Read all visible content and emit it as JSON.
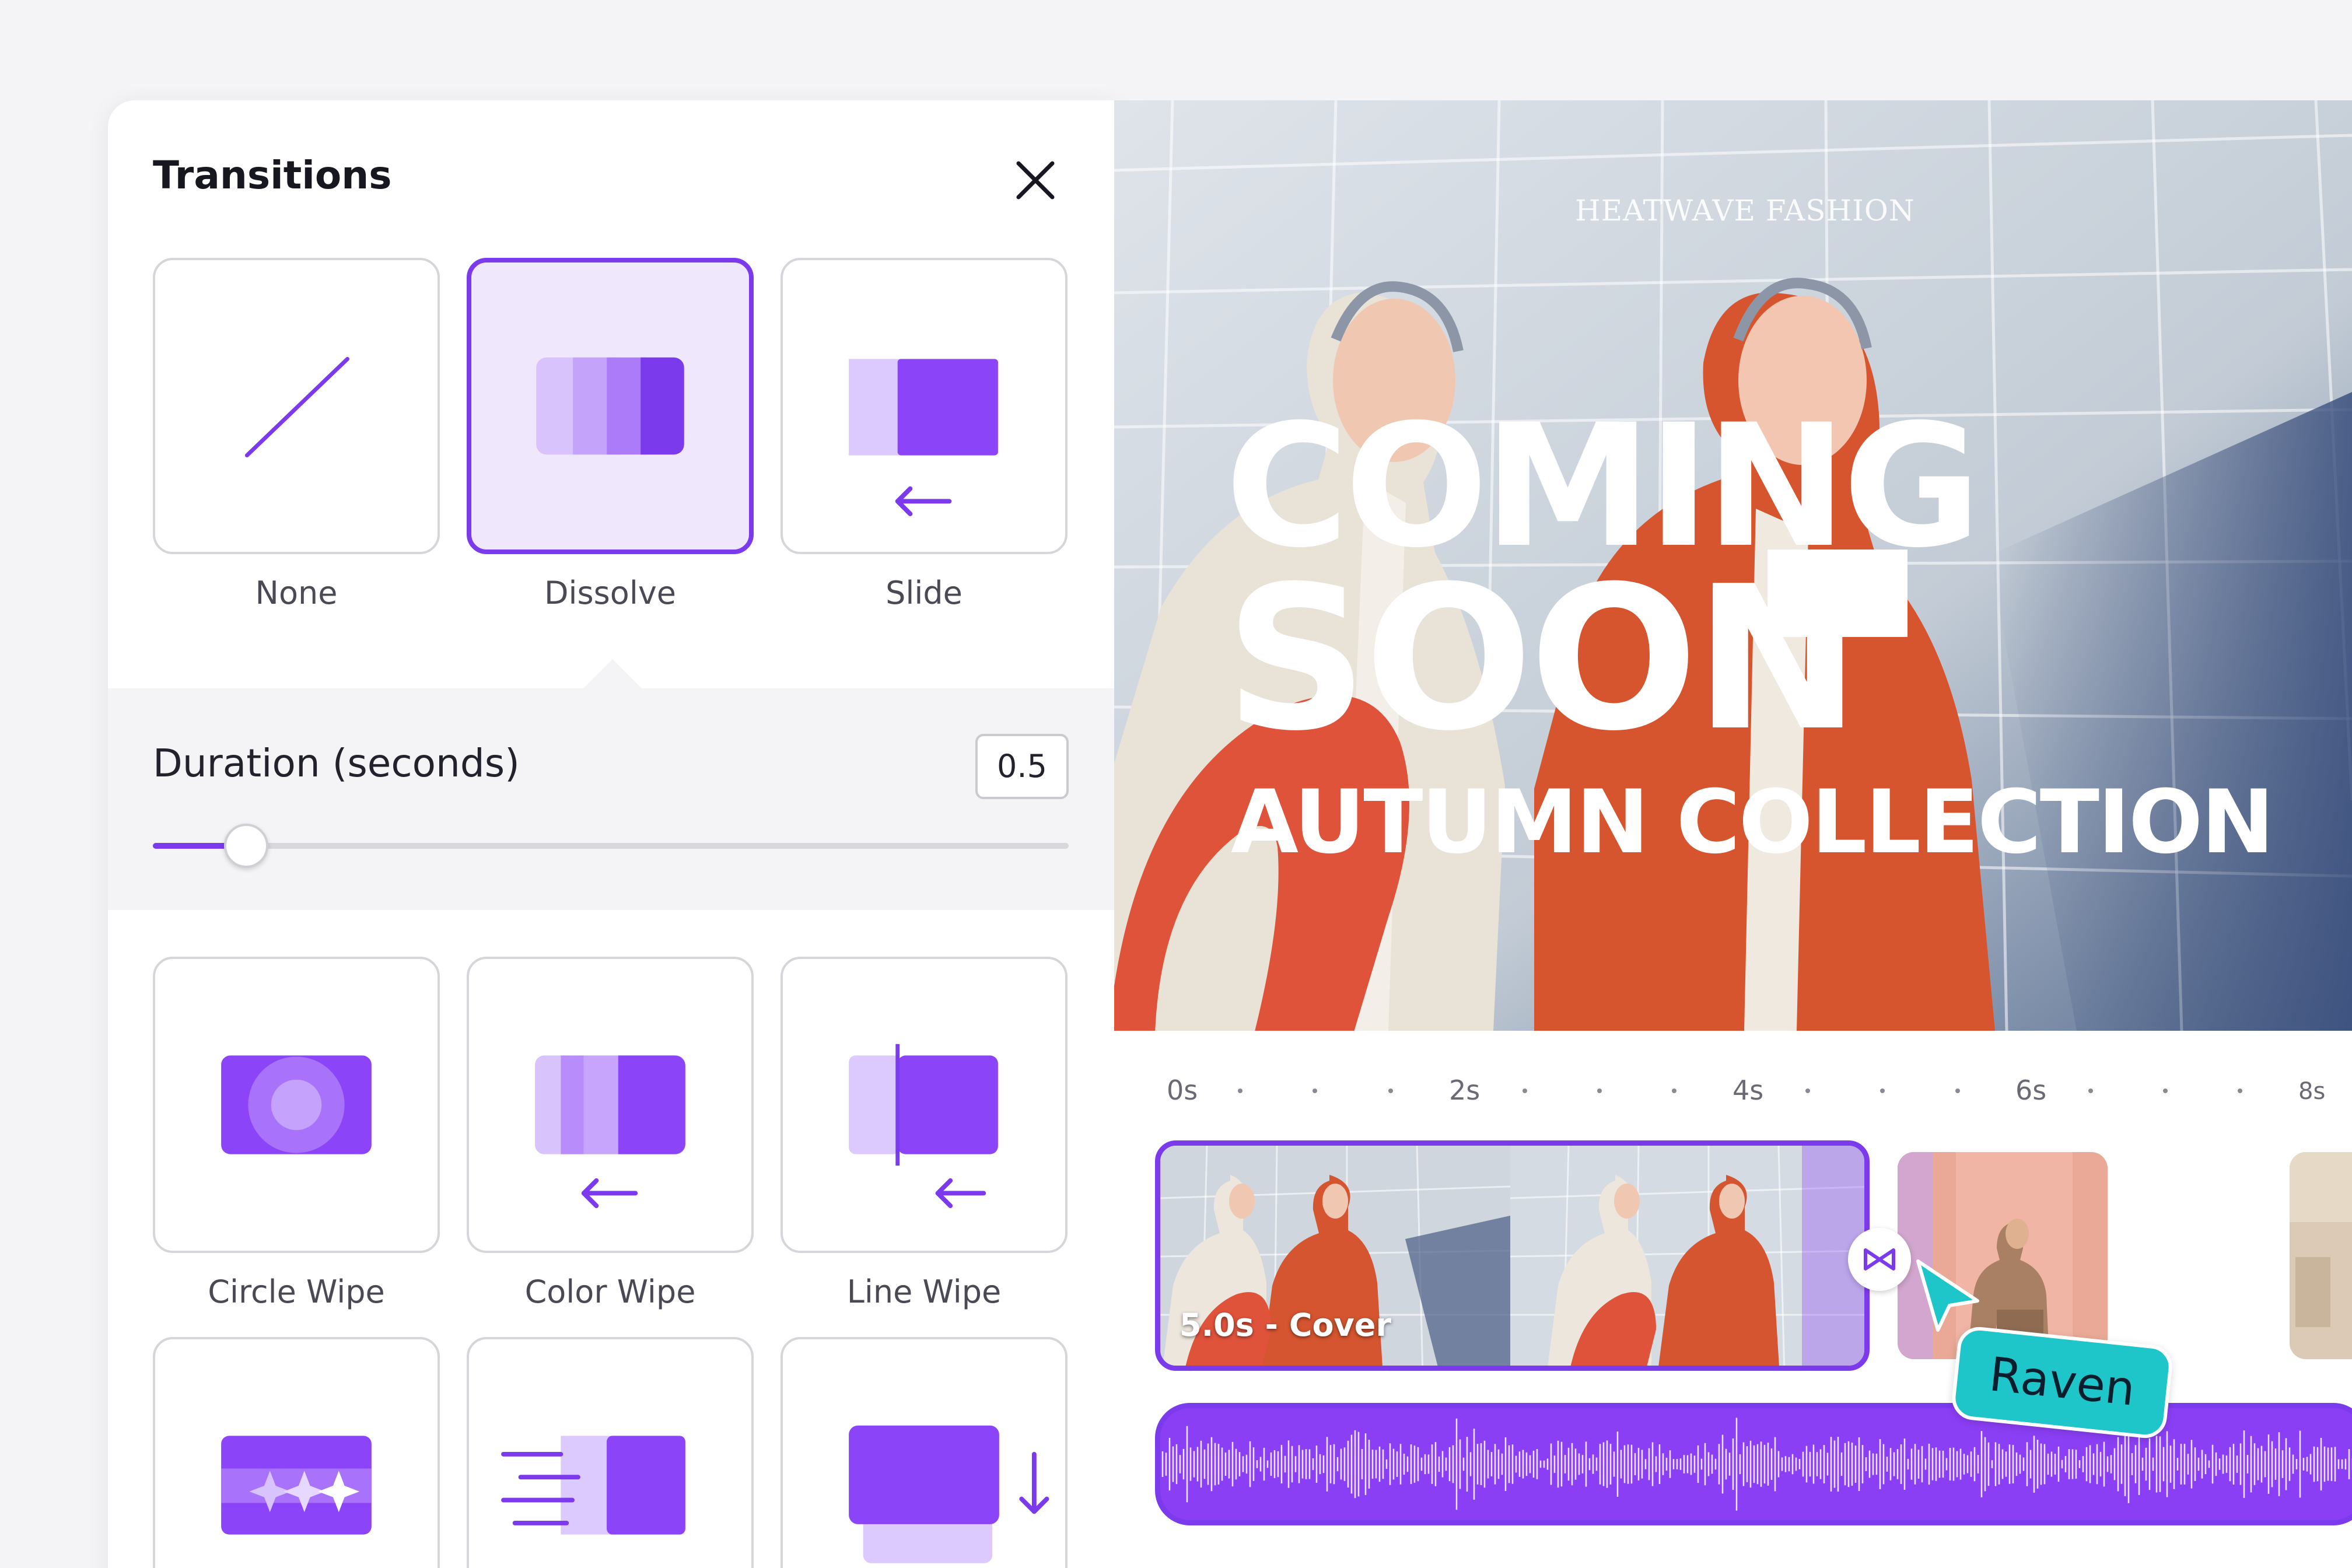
{
  "panel": {
    "title": "Transitions",
    "close_icon": "close-icon"
  },
  "transitions": [
    {
      "label": "None",
      "icon": "none-icon",
      "selected": false
    },
    {
      "label": "Dissolve",
      "icon": "dissolve-icon",
      "selected": true
    },
    {
      "label": "Slide",
      "icon": "slide-icon",
      "selected": false
    },
    {
      "label": "Circle Wipe",
      "icon": "circle-wipe-icon",
      "selected": false
    },
    {
      "label": "Color Wipe",
      "icon": "color-wipe-icon",
      "selected": false
    },
    {
      "label": "Line Wipe",
      "icon": "line-wipe-icon",
      "selected": false
    },
    {
      "label": "",
      "icon": "stars-wipe-icon",
      "selected": false
    },
    {
      "label": "",
      "icon": "speed-slide-icon",
      "selected": false
    },
    {
      "label": "",
      "icon": "drop-icon",
      "selected": false
    }
  ],
  "duration": {
    "label": "Duration (seconds)",
    "value": "0.5",
    "slider_fraction": 0.102
  },
  "preview": {
    "brand": "HEATWAVE FASHION",
    "headline_line1": "COMING",
    "headline_line2": "SOON",
    "headline_line3": "AUTUMN COLLECTION"
  },
  "timeline": {
    "ruler_labels": [
      "0s",
      "2s",
      "4s",
      "6s",
      "8s"
    ],
    "clip_label": "5.0s - Cover",
    "transition_icon": "bowtie-transition-icon",
    "collaborator": "Raven"
  },
  "colors": {
    "accent": "#7c3aed",
    "accent_light": "#efe8fd",
    "collaborator": "#1ec5c9"
  }
}
